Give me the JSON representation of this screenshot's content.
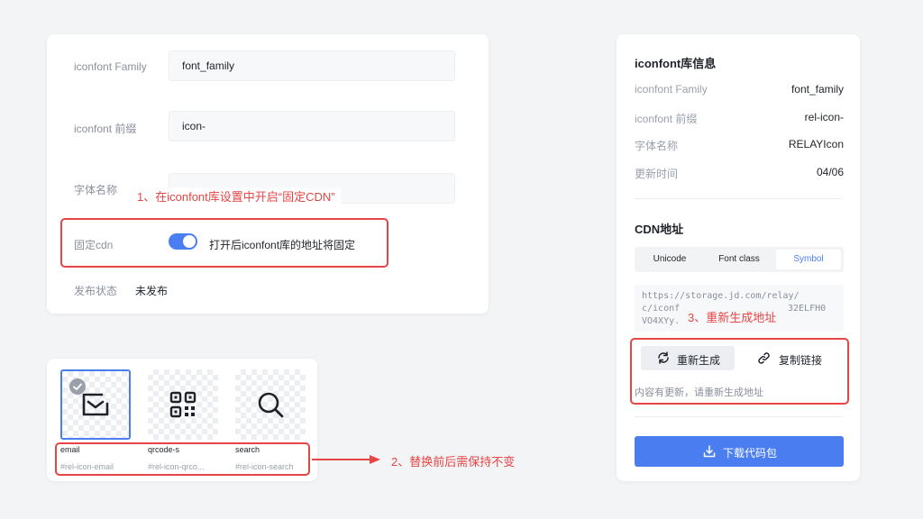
{
  "form": {
    "family_label": "iconfont Family",
    "family_value": "font_family",
    "prefix_label": "iconfont 前缀",
    "prefix_value": "icon-",
    "fontname_label": "字体名称",
    "cdn_label": "固定cdn",
    "cdn_toggle_on": true,
    "cdn_toggle_text": "打开后iconfont库的地址将固定",
    "publish_label": "发布状态",
    "publish_value": "未发布"
  },
  "annotations": {
    "step1": "1、在iconfont库设置中开启“固定CDN”",
    "step2": "2、替换前后需保持不变",
    "step3": "3、重新生成地址",
    "color": "#e64545"
  },
  "icons": [
    {
      "name": "email",
      "class": "#rel-icon-email",
      "icon": "email-icon",
      "selected": true
    },
    {
      "name": "qrcode-s",
      "class": "#rel-icon-qrco...",
      "icon": "qrcode-icon",
      "selected": false
    },
    {
      "name": "search",
      "class": "#rel-icon-search",
      "icon": "search-icon",
      "selected": false
    }
  ],
  "info": {
    "title": "iconfont库信息",
    "rows": [
      {
        "label": "iconfont Family",
        "value": "font_family"
      },
      {
        "label": "iconfont 前缀",
        "value": "rel-icon-"
      },
      {
        "label": "字体名称",
        "value": "RELAYIcon"
      },
      {
        "label": "更新时间",
        "value": "04/06"
      }
    ]
  },
  "cdn": {
    "title": "CDN地址",
    "tabs": [
      "Unicode",
      "Font class",
      "Symbol"
    ],
    "active_tab": "Symbol",
    "code_lines": [
      "https://storage.jd.com/relay/",
      "c/iconf",
      "32ELFH0",
      "VO4XYy."
    ],
    "regen_label": "重新生成",
    "copy_label": "复制链接",
    "hint": "内容有更新，请重新生成地址",
    "download_label": "下载代码包"
  },
  "colors": {
    "accent": "#4a7ef0",
    "annotation": "#e64545"
  }
}
